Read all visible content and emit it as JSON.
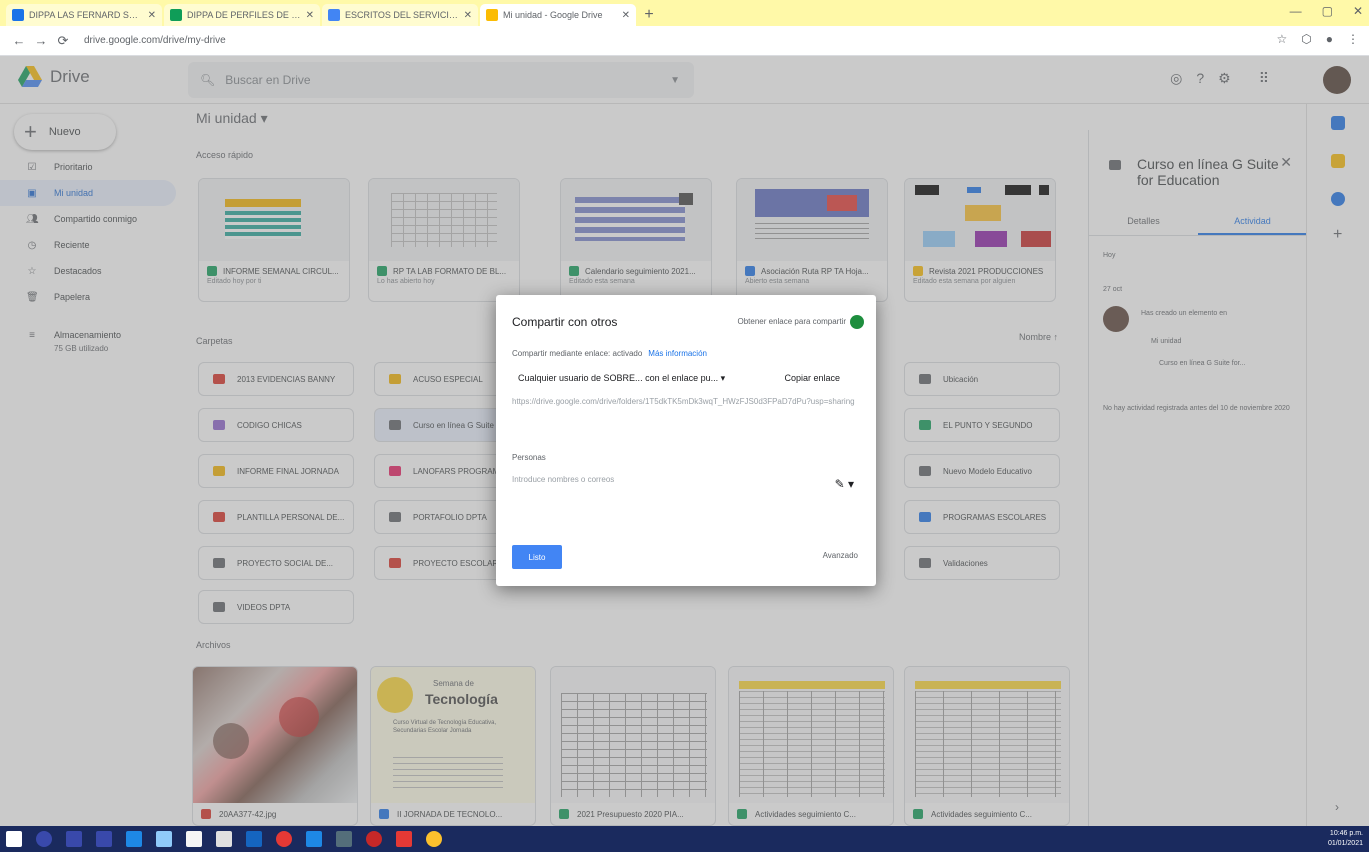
{
  "browser": {
    "tabs": [
      {
        "title": "DIPPA LAS FERNARD SN FDOT",
        "color": "#1a73e8"
      },
      {
        "title": "DIPPA DE PERFILES DE RISP",
        "color": "#0f9d58"
      },
      {
        "title": "ESCRITOS DEL SERVICIOS AL",
        "color": "#4285f4"
      },
      {
        "title": "Mi unidad - Google Drive",
        "color": "#fbbc04"
      }
    ],
    "new_tab": "+",
    "url": "drive.google.com/drive/my-drive"
  },
  "drive": {
    "app_name": "Drive",
    "search_placeholder": "Buscar en Drive",
    "new_button": "Nuevo",
    "breadcrumb": "Mi unidad ▾",
    "quick_access_label": "Acceso rápido",
    "folders_label": "Carpetas",
    "files_label": "Archivos",
    "sort_label": "Nombre ↑"
  },
  "sidebar": {
    "items": [
      {
        "label": "Prioritario",
        "icon": "priority-icon"
      },
      {
        "label": "Mi unidad",
        "icon": "my-drive-icon"
      },
      {
        "label": "Compartido conmigo",
        "icon": "shared-icon"
      },
      {
        "label": "Reciente",
        "icon": "recent-icon"
      },
      {
        "label": "Destacados",
        "icon": "star-icon"
      },
      {
        "label": "Papelera",
        "icon": "trash-icon"
      },
      {
        "label": "Almacenamiento",
        "icon": "storage-icon"
      }
    ],
    "storage_used": "75 GB utilizado"
  },
  "quick_access": [
    {
      "title": "INFORME SEMANAL CIRCUL...",
      "sub": "Editado hoy por ti",
      "color": "#0f9d58"
    },
    {
      "title": "RP TA LAB FORMATO DE BL...",
      "sub": "Lo has abierto hoy",
      "color": "#0f9d58"
    },
    {
      "title": "Calendario seguimiento 2021...",
      "sub": "Editado esta semana",
      "color": "#0f9d58"
    },
    {
      "title": "Asociación Ruta RP TA Hoja...",
      "sub": "Abierto esta semana",
      "color": "#1a73e8"
    },
    {
      "title": "Revista 2021 PRODUCCIONES",
      "sub": "Editado esta semana por alguien",
      "color": "#fbbc04"
    }
  ],
  "folders": [
    {
      "label": "2013 EVIDENCIAS BANNY",
      "color": "#d93025"
    },
    {
      "label": "ACUSO ESPECIAL",
      "color": "#f4b400"
    },
    {
      "label": "Ubicación",
      "color": "#5f6368"
    },
    {
      "label": "CODIGO CHICAS",
      "color": "#8e63ce"
    },
    {
      "label": "Curso en línea G Suite",
      "color": "#5f6368"
    },
    {
      "label": "EL PUNTO Y SEGUNDO",
      "color": "#0f9d58"
    },
    {
      "label": "INFORME FINAL JORNADA",
      "color": "#f4b400"
    },
    {
      "label": "LANOFARS PROGRAMA",
      "color": "#e91e63"
    },
    {
      "label": "Nuevo Modelo Educativo",
      "color": "#5f6368"
    },
    {
      "label": "PLANTILLA PERSONAL DE...",
      "color": "#d93025"
    },
    {
      "label": "PORTAFOLIO DPTA",
      "color": "#5f6368"
    },
    {
      "label": "PROGRAMAS ESCOLARES",
      "color": "#1a73e8"
    },
    {
      "label": "PROYECTO SOCIAL DE...",
      "color": "#5f6368"
    },
    {
      "label": "PROYECTO ESCOLAR",
      "color": "#d93025"
    },
    {
      "label": "Validaciones",
      "color": "#5f6368"
    },
    {
      "label": "VIDEOS DPTA",
      "color": "#5f6368"
    }
  ],
  "files": [
    {
      "title": "20AA377-42.jpg",
      "color": "#d93025"
    },
    {
      "title": "II JORNADA DE TECNOLO...",
      "color": "#1a73e8"
    },
    {
      "title": "2021 Presupuesto 2020 PIA...",
      "color": "#0f9d58"
    },
    {
      "title": "Actividades seguimiento C...",
      "color": "#0f9d58"
    },
    {
      "title": "Actividades seguimiento C...",
      "color": "#0f9d58"
    }
  ],
  "file_thumb_text": {
    "tech_small": "Semana de",
    "tech_big": "Tecnología",
    "tech_body": "Curso Virtual de Tecnología Educativa, Secundarias Escolar Jornada"
  },
  "details": {
    "title": "Curso en línea G Suite for Education",
    "tab_details": "Detalles",
    "tab_activity": "Actividad",
    "today_label": "Hoy",
    "date_label": "27 oct",
    "activity_text": "Has creado un elemento en",
    "activity_folder": "Mi unidad",
    "activity_item": "Curso en línea G Suite for...",
    "no_activity": "No hay actividad registrada antes del 10 de noviembre 2020"
  },
  "dialog": {
    "title": "Compartir con otros",
    "advanced_top": "Obtener enlace para compartir",
    "link_on": "Compartir mediante enlace: activado",
    "more_info": "Más información",
    "who": "Cualquier usuario de SOBRE...  con el enlace pu...  ▾",
    "copy_link": "Copiar enlace",
    "link_url": "https://drive.google.com/drive/folders/1T5dkTK5mDk3wqT_HWzFJS0d3FPaD7dPu?usp=sharing",
    "people_label": "Personas",
    "people_placeholder": "Introduce nombres o correos",
    "done_button": "Listo",
    "advanced_bottom": "Avanzado"
  },
  "taskbar": {
    "time": "10:46 p.m.",
    "date": "01/01/2021"
  }
}
